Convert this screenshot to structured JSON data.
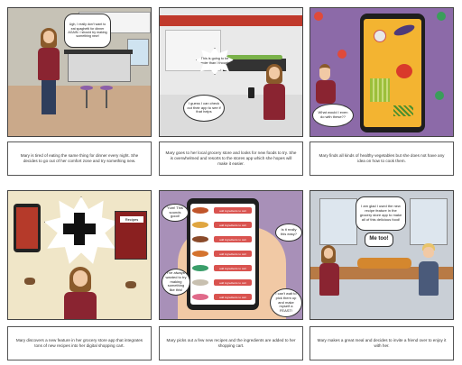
{
  "panels": [
    {
      "bubbles": [
        "Ugh, I really don't want to eat spaghetti for dinner AGAIN. I should try making something new!"
      ]
    },
    {
      "bubbles": [
        "This is going to be harder than I thought!",
        "I guess I can check out their app to see if that helps"
      ]
    },
    {
      "bubbles": [
        "What would I even do with these??"
      ]
    },
    {
      "recipes_label": "Recipes"
    },
    {
      "bubbles": [
        "Yum! This sounds good!",
        "Is it really this easy?",
        "I've always wanted to try making something like this!",
        "I can't wait to pick them up and make myself a FEAST!"
      ],
      "button_label": "add ingredients to cart"
    },
    {
      "bubbles": [
        "I am glad I used the new recipe feature in the grocery store app to make all of this delicious food!",
        "Me too!"
      ]
    }
  ],
  "captions": [
    "Mary is tired of eating the same thing for dinner every night. She decides to go out of her comfort zone and try something new.",
    "Mary goes to her local grocery store and looks for new foods to try. She is overwhelmed and resorts to the stores app which she hopes will make it easier.",
    "Mary finds all kinds of healthy vegetables but she does not have any idea on how to cook them.",
    "Mary discovers a new feature in her grocery store app that integrates tons of new recipes into her digital shopping cart.",
    "Mary picks out a few new recipes and the ingredients are added to her shopping cart.",
    "Mary makes a great meal and decides to invite a friend over to enjoy it with her."
  ],
  "colors": {
    "accent": "#d9534f",
    "kitchen_wall": "#c6c2b6",
    "store_wall": "#e9e9e9",
    "purple_bg": "#8c6aa8",
    "table": "#b87a45"
  }
}
